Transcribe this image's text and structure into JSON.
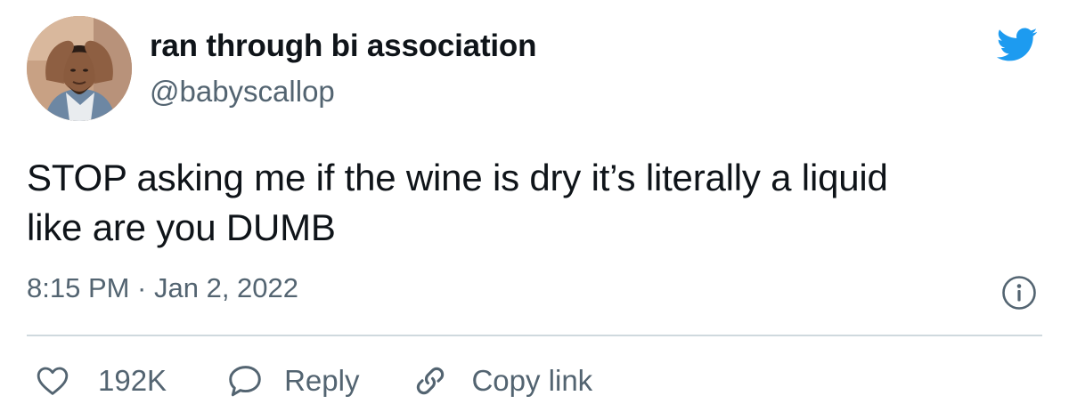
{
  "author": {
    "display_name": "ran through bi association",
    "handle": "@babyscallop",
    "avatar_icon": "profile-photo"
  },
  "brand": {
    "logo_icon": "twitter-bird-icon",
    "color": "#1d9bf0"
  },
  "tweet": {
    "text_line1": "STOP asking me if the wine is dry it’s literally a liquid",
    "text_line2": "like are you DUMB",
    "timestamp": "8:15 PM · Jan 2, 2022"
  },
  "actions": {
    "like_icon": "heart-icon",
    "like_count": "192K",
    "reply_icon": "speech-bubble-icon",
    "reply_label": "Reply",
    "copy_icon": "link-icon",
    "copy_label": "Copy link",
    "info_icon": "info-icon"
  },
  "colors": {
    "text_primary": "#0f1419",
    "text_secondary": "#536471",
    "divider": "#cfd9de"
  }
}
